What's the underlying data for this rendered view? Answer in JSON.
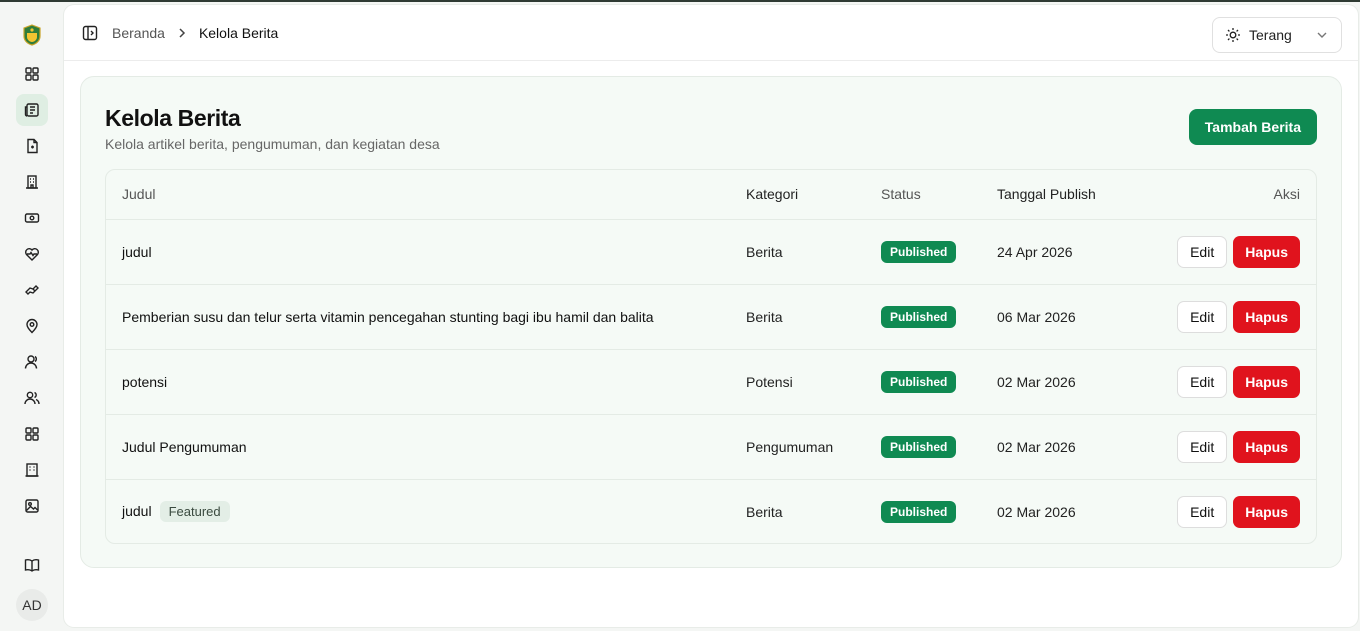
{
  "colors": {
    "primary": "#0f8a52",
    "danger": "#e0131d",
    "active_nav": "#dfeee3"
  },
  "sidebar": {
    "items": [
      {
        "icon": "dashboard-grid-icon"
      },
      {
        "icon": "newspaper-icon",
        "active": true
      },
      {
        "icon": "document-icon"
      },
      {
        "icon": "building-icon"
      },
      {
        "icon": "money-icon"
      },
      {
        "icon": "heart-pulse-icon"
      },
      {
        "icon": "handshake-icon"
      },
      {
        "icon": "map-pin-icon"
      },
      {
        "icon": "user-icon"
      },
      {
        "icon": "users-icon"
      },
      {
        "icon": "apps-grid-icon"
      },
      {
        "icon": "office-building-icon"
      },
      {
        "icon": "image-icon"
      },
      {
        "icon": "briefcase-icon"
      }
    ],
    "book_icon": "book-icon",
    "avatar_initials": "AD"
  },
  "header": {
    "breadcrumb": [
      "Beranda",
      "Kelola Berita"
    ],
    "theme_label": "Terang"
  },
  "page": {
    "title": "Kelola Berita",
    "subtitle": "Kelola artikel berita, pengumuman, dan kegiatan desa",
    "add_button": "Tambah Berita"
  },
  "table": {
    "columns": [
      "Judul",
      "Kategori",
      "Status",
      "Tanggal Publish",
      "Aksi"
    ],
    "rows": [
      {
        "judul": "judul",
        "featured": "",
        "kategori": "Berita",
        "status": "Published",
        "tanggal": "24 Apr 2026"
      },
      {
        "judul": "Pemberian susu dan telur serta vitamin pencegahan stunting bagi ibu hamil dan balita",
        "featured": "",
        "kategori": "Berita",
        "status": "Published",
        "tanggal": "06 Mar 2026"
      },
      {
        "judul": "potensi",
        "featured": "",
        "kategori": "Potensi",
        "status": "Published",
        "tanggal": "02 Mar 2026"
      },
      {
        "judul": "Judul Pengumuman",
        "featured": "",
        "kategori": "Pengumuman",
        "status": "Published",
        "tanggal": "02 Mar 2026"
      },
      {
        "judul": "judul",
        "featured": "Featured",
        "kategori": "Berita",
        "status": "Published",
        "tanggal": "02 Mar 2026"
      }
    ],
    "edit_label": "Edit",
    "delete_label": "Hapus"
  }
}
